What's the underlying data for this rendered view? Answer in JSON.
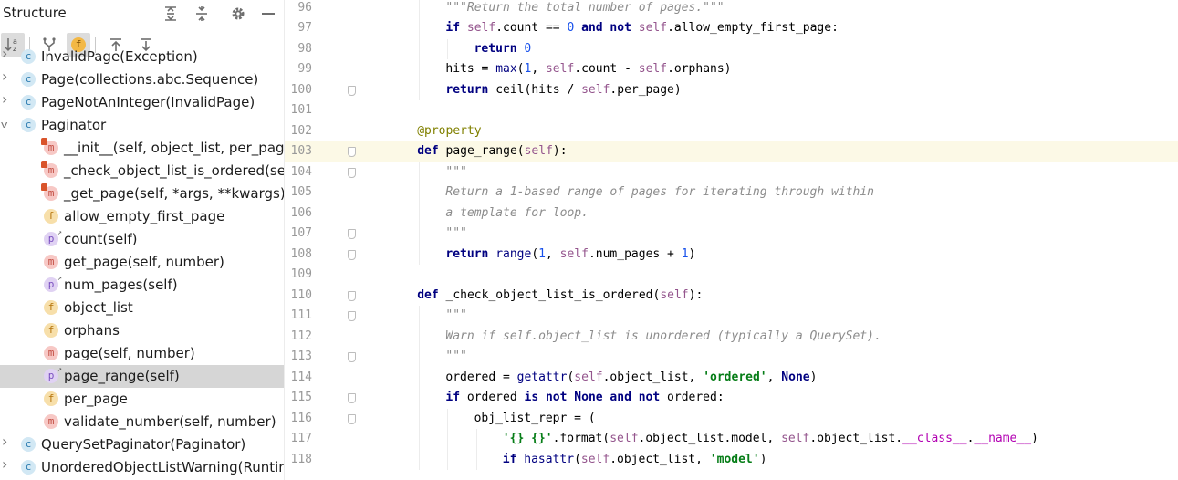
{
  "structure": {
    "title": "Structure",
    "header_icons": [
      "expand-all-icon",
      "collapse-all-icon",
      "gear-icon",
      "minimize-icon"
    ],
    "toolbar_icons": [
      "sort-alphabetically-icon",
      "show-inherited-icon",
      "show-fields-icon",
      "navigate-from-source-icon",
      "navigate-to-source-icon"
    ],
    "tree": [
      {
        "label": "InvalidPage(Exception)",
        "kind": "class",
        "icon_letter": "c",
        "depth": 0,
        "chevron": "right"
      },
      {
        "label": "Page(collections.abc.Sequence)",
        "kind": "class",
        "icon_letter": "c",
        "depth": 0,
        "chevron": "right"
      },
      {
        "label": "PageNotAnInteger(InvalidPage)",
        "kind": "class",
        "icon_letter": "c",
        "depth": 0,
        "chevron": "right"
      },
      {
        "label": "Paginator",
        "kind": "class",
        "icon_letter": "c",
        "depth": 0,
        "chevron": "down"
      },
      {
        "label": "__init__(self, object_list, per_page",
        "kind": "method",
        "icon_letter": "m",
        "depth": 1,
        "private": true
      },
      {
        "label": "_check_object_list_is_ordered(sel",
        "kind": "method",
        "icon_letter": "m",
        "depth": 1,
        "private": true
      },
      {
        "label": "_get_page(self, *args, **kwargs)",
        "kind": "method",
        "icon_letter": "m",
        "depth": 1,
        "private": true
      },
      {
        "label": "allow_empty_first_page",
        "kind": "field",
        "icon_letter": "f",
        "depth": 1
      },
      {
        "label": "count(self)",
        "kind": "property",
        "icon_letter": "p",
        "depth": 1
      },
      {
        "label": "get_page(self, number)",
        "kind": "method",
        "icon_letter": "m",
        "depth": 1
      },
      {
        "label": "num_pages(self)",
        "kind": "property",
        "icon_letter": "p",
        "depth": 1
      },
      {
        "label": "object_list",
        "kind": "field",
        "icon_letter": "f",
        "depth": 1
      },
      {
        "label": "orphans",
        "kind": "field",
        "icon_letter": "f",
        "depth": 1
      },
      {
        "label": "page(self, number)",
        "kind": "method",
        "icon_letter": "m",
        "depth": 1
      },
      {
        "label": "page_range(self)",
        "kind": "property",
        "icon_letter": "p",
        "depth": 1,
        "selected": true
      },
      {
        "label": "per_page",
        "kind": "field",
        "icon_letter": "f",
        "depth": 1
      },
      {
        "label": "validate_number(self, number)",
        "kind": "method",
        "icon_letter": "m",
        "depth": 1
      },
      {
        "label": "QuerySetPaginator(Paginator)",
        "kind": "class",
        "icon_letter": "c",
        "depth": 0,
        "chevron": "right"
      },
      {
        "label": "UnorderedObjectListWarning(Runtin",
        "kind": "class",
        "icon_letter": "c",
        "depth": 0,
        "chevron": "right"
      }
    ]
  },
  "editor": {
    "current_line": 103,
    "lines": [
      {
        "n": 96,
        "indent": 2,
        "tokens": [
          [
            "doc",
            "\"\"\"Return the total number of pages.\"\"\""
          ]
        ]
      },
      {
        "n": 97,
        "indent": 2,
        "tokens": [
          [
            "kw",
            "if "
          ],
          [
            "self",
            "self"
          ],
          [
            "",
            ".count == "
          ],
          [
            "num",
            "0"
          ],
          [
            "",
            " "
          ],
          [
            "kw",
            "and not "
          ],
          [
            "self",
            "self"
          ],
          [
            "",
            ".allow_empty_first_page:"
          ]
        ]
      },
      {
        "n": 98,
        "indent": 3,
        "tokens": [
          [
            "kw",
            "return "
          ],
          [
            "num",
            "0"
          ]
        ]
      },
      {
        "n": 99,
        "indent": 2,
        "tokens": [
          [
            "",
            "hits = "
          ],
          [
            "bi",
            "max"
          ],
          [
            "",
            "("
          ],
          [
            "num",
            "1"
          ],
          [
            "",
            ", "
          ],
          [
            "self",
            "self"
          ],
          [
            "",
            ".count - "
          ],
          [
            "self",
            "self"
          ],
          [
            "",
            ".orphans)"
          ]
        ]
      },
      {
        "n": 100,
        "indent": 2,
        "fold": true,
        "tokens": [
          [
            "kw",
            "return "
          ],
          [
            "",
            "ceil(hits / "
          ],
          [
            "self",
            "self"
          ],
          [
            "",
            ".per_page)"
          ]
        ]
      },
      {
        "n": 101,
        "indent": 0,
        "tokens": []
      },
      {
        "n": 102,
        "indent": 1,
        "tokens": [
          [
            "deco",
            "@property"
          ]
        ]
      },
      {
        "n": 103,
        "indent": 1,
        "fold": true,
        "tokens": [
          [
            "kw",
            "def "
          ],
          [
            "fn",
            "page_range"
          ],
          [
            "",
            "("
          ],
          [
            "self",
            "self"
          ],
          [
            "",
            "):"
          ]
        ]
      },
      {
        "n": 104,
        "indent": 2,
        "fold": true,
        "tokens": [
          [
            "doc",
            "\"\"\""
          ]
        ]
      },
      {
        "n": 105,
        "indent": 2,
        "tokens": [
          [
            "doc",
            "Return a 1-based range of pages for iterating through within"
          ]
        ]
      },
      {
        "n": 106,
        "indent": 2,
        "tokens": [
          [
            "doc",
            "a template for loop."
          ]
        ]
      },
      {
        "n": 107,
        "indent": 2,
        "fold": true,
        "tokens": [
          [
            "doc",
            "\"\"\""
          ]
        ]
      },
      {
        "n": 108,
        "indent": 2,
        "fold": true,
        "tokens": [
          [
            "kw",
            "return "
          ],
          [
            "bi",
            "range"
          ],
          [
            "",
            "("
          ],
          [
            "num",
            "1"
          ],
          [
            "",
            ", "
          ],
          [
            "self",
            "self"
          ],
          [
            "",
            ".num_pages + "
          ],
          [
            "num",
            "1"
          ],
          [
            "",
            ")"
          ]
        ]
      },
      {
        "n": 109,
        "indent": 0,
        "tokens": []
      },
      {
        "n": 110,
        "indent": 1,
        "fold": true,
        "tokens": [
          [
            "kw",
            "def "
          ],
          [
            "fn",
            "_check_object_list_is_ordered"
          ],
          [
            "",
            "("
          ],
          [
            "self",
            "self"
          ],
          [
            "",
            "):"
          ]
        ]
      },
      {
        "n": 111,
        "indent": 2,
        "fold": true,
        "tokens": [
          [
            "doc",
            "\"\"\""
          ]
        ]
      },
      {
        "n": 112,
        "indent": 2,
        "tokens": [
          [
            "doc",
            "Warn if self.object_list is unordered (typically a QuerySet)."
          ]
        ]
      },
      {
        "n": 113,
        "indent": 2,
        "fold": true,
        "tokens": [
          [
            "doc",
            "\"\"\""
          ]
        ]
      },
      {
        "n": 114,
        "indent": 2,
        "tokens": [
          [
            "",
            "ordered = "
          ],
          [
            "bi",
            "getattr"
          ],
          [
            "",
            "("
          ],
          [
            "self",
            "self"
          ],
          [
            "",
            ".object_list, "
          ],
          [
            "str",
            "'ordered'"
          ],
          [
            "",
            ", "
          ],
          [
            "kw",
            "None"
          ],
          [
            "",
            ")"
          ]
        ]
      },
      {
        "n": 115,
        "indent": 2,
        "fold": true,
        "tokens": [
          [
            "kw",
            "if "
          ],
          [
            "",
            "ordered "
          ],
          [
            "kw",
            "is not None and not "
          ],
          [
            "",
            "ordered:"
          ]
        ]
      },
      {
        "n": 116,
        "indent": 3,
        "fold": true,
        "tokens": [
          [
            "",
            "obj_list_repr = ("
          ]
        ]
      },
      {
        "n": 117,
        "indent": 4,
        "tokens": [
          [
            "str",
            "'{} {}'"
          ],
          [
            "",
            ".format("
          ],
          [
            "self",
            "self"
          ],
          [
            "",
            ".object_list.model, "
          ],
          [
            "self",
            "self"
          ],
          [
            "",
            ".object_list."
          ],
          [
            "dunder",
            "__class__"
          ],
          [
            "",
            "."
          ],
          [
            "dunder",
            "__name__"
          ],
          [
            "",
            ")"
          ]
        ]
      },
      {
        "n": 118,
        "indent": 4,
        "tokens": [
          [
            "kw",
            "if "
          ],
          [
            "bi",
            "hasattr"
          ],
          [
            "",
            "("
          ],
          [
            "self",
            "self"
          ],
          [
            "",
            ".object_list, "
          ],
          [
            "str",
            "'model'"
          ],
          [
            "",
            ")"
          ]
        ]
      }
    ]
  }
}
